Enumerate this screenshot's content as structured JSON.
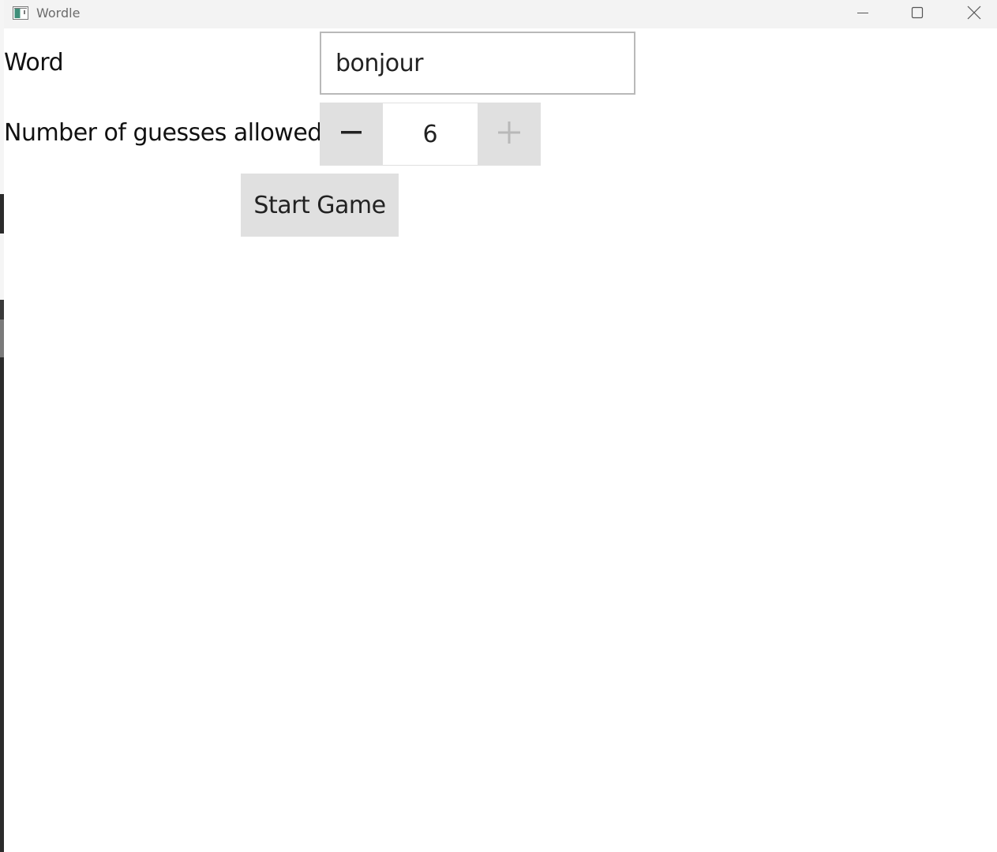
{
  "window": {
    "title": "Wordle",
    "app_icon": "window-app-icon",
    "controls": [
      "minimize-icon",
      "maximize-icon",
      "close-icon"
    ]
  },
  "form": {
    "word_label": "Word",
    "word_value": "bonjour",
    "guesses_label": "Number of guesses allowed",
    "guesses_value": "6",
    "decrement_icon": "minus-icon",
    "increment_icon": "plus-icon",
    "start_button_label": "Start Game"
  },
  "colors": {
    "button_bg": "#e0e0e0",
    "titlebar_bg": "#f3f3f3",
    "text": "#222222",
    "disabled_glyph": "#b8b8b8"
  }
}
